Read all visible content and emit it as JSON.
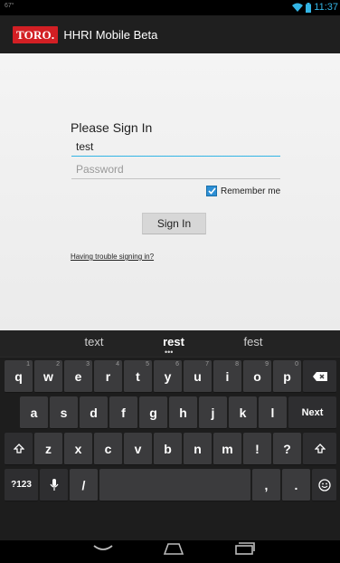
{
  "status_bar": {
    "left_text": "67°",
    "time": "11:37"
  },
  "app_bar": {
    "logo_text": "TORO.",
    "title": "HHRI Mobile Beta"
  },
  "form": {
    "title": "Please Sign In",
    "username_value": "test",
    "password_placeholder": "Password",
    "remember_label": "Remember me",
    "remember_checked": true,
    "signin_label": "Sign In",
    "trouble_link": "Having trouble signing in?"
  },
  "keyboard": {
    "suggestions": [
      "text",
      "rest",
      "fest"
    ],
    "row1": [
      {
        "label": "q",
        "hint": "1"
      },
      {
        "label": "w",
        "hint": "2"
      },
      {
        "label": "e",
        "hint": "3"
      },
      {
        "label": "r",
        "hint": "4"
      },
      {
        "label": "t",
        "hint": "5"
      },
      {
        "label": "y",
        "hint": "6"
      },
      {
        "label": "u",
        "hint": "7"
      },
      {
        "label": "i",
        "hint": "8"
      },
      {
        "label": "o",
        "hint": "9"
      },
      {
        "label": "p",
        "hint": "0"
      }
    ],
    "row2": [
      "a",
      "s",
      "d",
      "f",
      "g",
      "h",
      "j",
      "k",
      "l"
    ],
    "next_label": "Next",
    "row3": [
      "z",
      "x",
      "c",
      "v",
      "b",
      "n",
      "m",
      "!",
      "?"
    ],
    "symbols_label": "?123",
    "slash_label": "/",
    "comma_label": ",",
    "period_label": "."
  }
}
